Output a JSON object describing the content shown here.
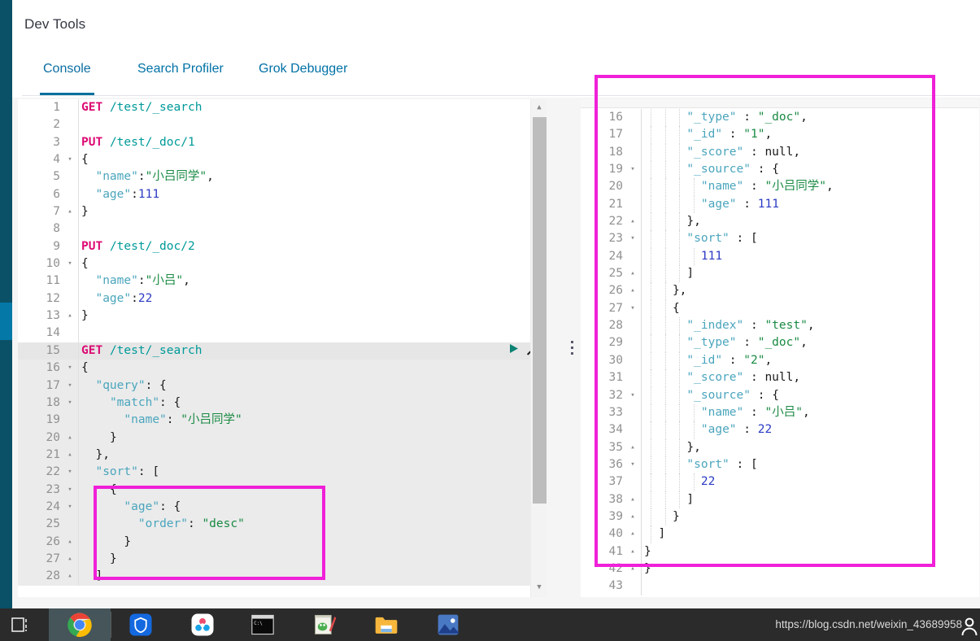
{
  "app": {
    "title": "Dev Tools",
    "rail_color": "#0a5167",
    "rail_active_color": "#0479a8",
    "accent_color": "#0071a6",
    "annotation_color": "#f020d8"
  },
  "tabs": [
    {
      "label": "Console",
      "selected": true
    },
    {
      "label": "Search Profiler",
      "selected": false
    },
    {
      "label": "Grok Debugger",
      "selected": false
    }
  ],
  "editor": {
    "active_line": 15,
    "run_icon": "play-icon",
    "wrench_icon": "wrench-icon",
    "scroll_up_icon": "triangle-up-icon",
    "scroll_down_icon": "triangle-down-icon",
    "lines": [
      {
        "n": 1,
        "fold": "",
        "text": "GET /test/_search"
      },
      {
        "n": 2,
        "fold": "",
        "text": ""
      },
      {
        "n": 3,
        "fold": "",
        "text": "PUT /test/_doc/1"
      },
      {
        "n": 4,
        "fold": "▾",
        "text": "{"
      },
      {
        "n": 5,
        "fold": "",
        "text": "  \"name\":\"小吕同学\","
      },
      {
        "n": 6,
        "fold": "",
        "text": "  \"age\":111"
      },
      {
        "n": 7,
        "fold": "▴",
        "text": "}"
      },
      {
        "n": 8,
        "fold": "",
        "text": ""
      },
      {
        "n": 9,
        "fold": "",
        "text": "PUT /test/_doc/2"
      },
      {
        "n": 10,
        "fold": "▾",
        "text": "{"
      },
      {
        "n": 11,
        "fold": "",
        "text": "  \"name\":\"小吕\","
      },
      {
        "n": 12,
        "fold": "",
        "text": "  \"age\":22"
      },
      {
        "n": 13,
        "fold": "▴",
        "text": "}"
      },
      {
        "n": 14,
        "fold": "",
        "text": ""
      },
      {
        "n": 15,
        "fold": "",
        "text": "GET /test/_search"
      },
      {
        "n": 16,
        "fold": "▾",
        "text": "{"
      },
      {
        "n": 17,
        "fold": "▾",
        "text": "  \"query\": {"
      },
      {
        "n": 18,
        "fold": "▾",
        "text": "    \"match\": {"
      },
      {
        "n": 19,
        "fold": "",
        "text": "      \"name\": \"小吕同学\""
      },
      {
        "n": 20,
        "fold": "▴",
        "text": "    }"
      },
      {
        "n": 21,
        "fold": "▴",
        "text": "  },"
      },
      {
        "n": 22,
        "fold": "▾",
        "text": "  \"sort\": ["
      },
      {
        "n": 23,
        "fold": "▾",
        "text": "    {"
      },
      {
        "n": 24,
        "fold": "▾",
        "text": "      \"age\": {"
      },
      {
        "n": 25,
        "fold": "",
        "text": "        \"order\": \"desc\""
      },
      {
        "n": 26,
        "fold": "▴",
        "text": "      }"
      },
      {
        "n": 27,
        "fold": "▴",
        "text": "    }"
      },
      {
        "n": 28,
        "fold": "▴",
        "text": "  ]"
      }
    ]
  },
  "output": {
    "lines": [
      {
        "n": 16,
        "fold": "",
        "text": "      \"_type\" : \"_doc\","
      },
      {
        "n": 17,
        "fold": "",
        "text": "      \"_id\" : \"1\","
      },
      {
        "n": 18,
        "fold": "",
        "text": "      \"_score\" : null,"
      },
      {
        "n": 19,
        "fold": "▾",
        "text": "      \"_source\" : {"
      },
      {
        "n": 20,
        "fold": "",
        "text": "        \"name\" : \"小吕同学\","
      },
      {
        "n": 21,
        "fold": "",
        "text": "        \"age\" : 111"
      },
      {
        "n": 22,
        "fold": "▴",
        "text": "      },"
      },
      {
        "n": 23,
        "fold": "▾",
        "text": "      \"sort\" : ["
      },
      {
        "n": 24,
        "fold": "",
        "text": "        111"
      },
      {
        "n": 25,
        "fold": "▴",
        "text": "      ]"
      },
      {
        "n": 26,
        "fold": "▴",
        "text": "    },"
      },
      {
        "n": 27,
        "fold": "▾",
        "text": "    {"
      },
      {
        "n": 28,
        "fold": "",
        "text": "      \"_index\" : \"test\","
      },
      {
        "n": 29,
        "fold": "",
        "text": "      \"_type\" : \"_doc\","
      },
      {
        "n": 30,
        "fold": "",
        "text": "      \"_id\" : \"2\","
      },
      {
        "n": 31,
        "fold": "",
        "text": "      \"_score\" : null,"
      },
      {
        "n": 32,
        "fold": "▾",
        "text": "      \"_source\" : {"
      },
      {
        "n": 33,
        "fold": "",
        "text": "        \"name\" : \"小吕\","
      },
      {
        "n": 34,
        "fold": "",
        "text": "        \"age\" : 22"
      },
      {
        "n": 35,
        "fold": "▴",
        "text": "      },"
      },
      {
        "n": 36,
        "fold": "▾",
        "text": "      \"sort\" : ["
      },
      {
        "n": 37,
        "fold": "",
        "text": "        22"
      },
      {
        "n": 38,
        "fold": "▴",
        "text": "      ]"
      },
      {
        "n": 39,
        "fold": "▴",
        "text": "    }"
      },
      {
        "n": 40,
        "fold": "▴",
        "text": "  ]"
      },
      {
        "n": 41,
        "fold": "▴",
        "text": "}"
      },
      {
        "n": 42,
        "fold": "▴",
        "text": "}"
      },
      {
        "n": 43,
        "fold": "",
        "text": ""
      }
    ]
  },
  "annotations": [
    {
      "name": "sort-clause-highlight",
      "side": "editor"
    },
    {
      "name": "hits-result-highlight",
      "side": "output"
    }
  ],
  "taskbar": {
    "task_view_icon": "task-view-icon",
    "apps": [
      {
        "name": "chrome-icon",
        "label": "Google Chrome"
      },
      {
        "name": "shield-icon",
        "label": "Security"
      },
      {
        "name": "cloud-sync-icon",
        "label": "Cloud Sync"
      },
      {
        "name": "terminal-icon",
        "label": "Command Prompt"
      },
      {
        "name": "notepad-icon",
        "label": "Editor"
      },
      {
        "name": "folder-icon",
        "label": "File Explorer"
      },
      {
        "name": "photos-icon",
        "label": "Photos"
      }
    ],
    "url": "https://blog.csdn.net/weixin_43689958",
    "person_icon": "person-icon"
  }
}
